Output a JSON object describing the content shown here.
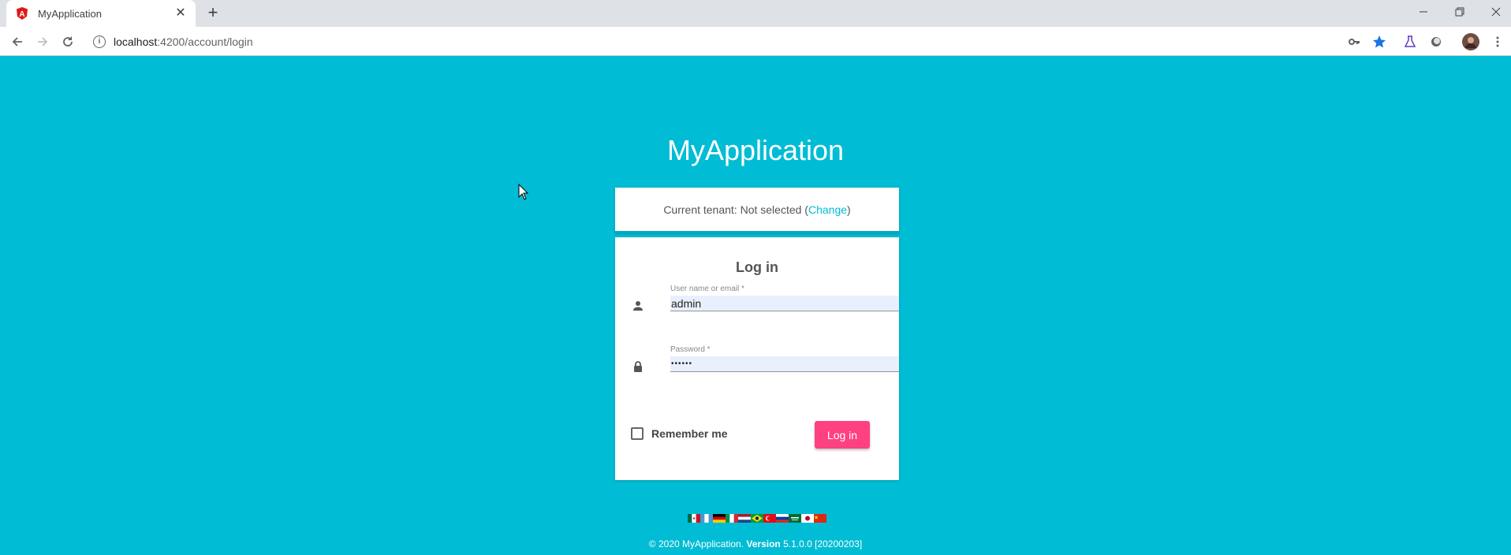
{
  "browser": {
    "tab_title": "MyApplication",
    "url_host": "localhost",
    "url_path": ":4200/account/login"
  },
  "page": {
    "app_title": "MyApplication",
    "tenant_text": "Current tenant: Not selected (",
    "tenant_link": "Change",
    "tenant_close": ")",
    "login_title": "Log in",
    "username_label": "User name or email *",
    "username_value": "admin",
    "password_label": "Password *",
    "password_value": "••••••",
    "remember_label": "Remember me",
    "login_button": "Log in",
    "footer_copyright": "© 2020 MyApplication.",
    "footer_version_label": "Version",
    "footer_version": "5.1.0.0 [20200203]"
  },
  "colors": {
    "background": "#00bcd4",
    "accent": "#ff4081",
    "link": "#00bcd4"
  },
  "language_flags": [
    "mexico-flag-icon",
    "guatemala-flag-icon",
    "germany-flag-icon",
    "italy-flag-icon",
    "netherlands-flag-icon",
    "brazil-flag-icon",
    "turkey-flag-icon",
    "russia-flag-icon",
    "saudi-arabia-flag-icon",
    "japan-flag-icon",
    "china-flag-icon"
  ]
}
